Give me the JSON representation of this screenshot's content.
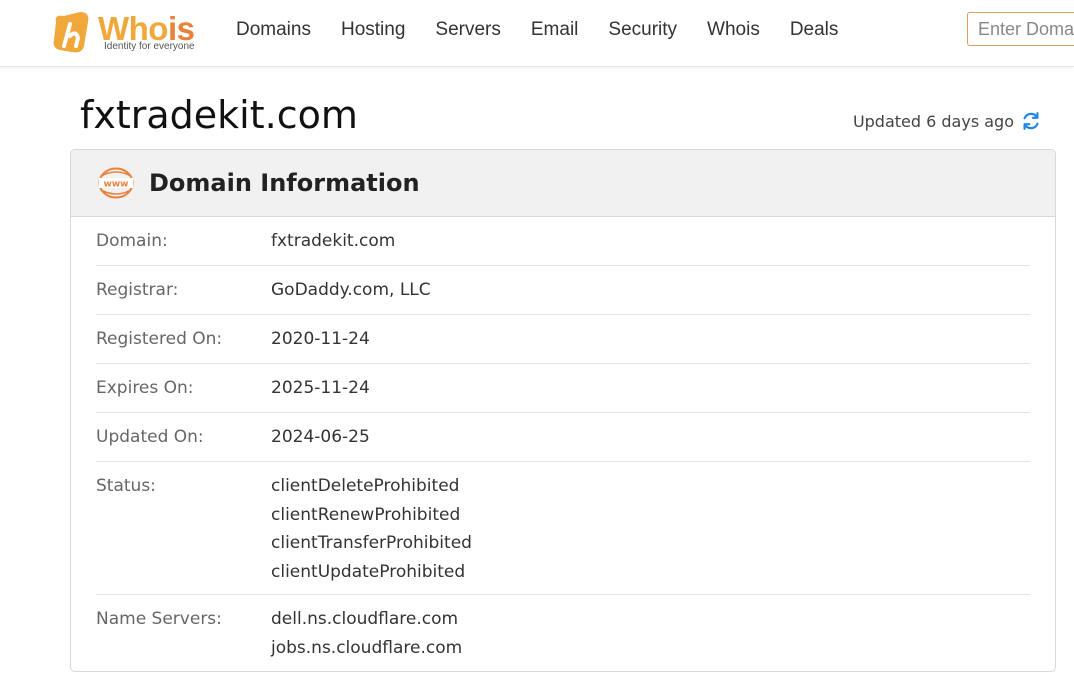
{
  "header": {
    "logo_text_a": "Who",
    "logo_text_b": "is",
    "tagline": "Identity for everyone",
    "nav": [
      "Domains",
      "Hosting",
      "Servers",
      "Email",
      "Security",
      "Whois",
      "Deals"
    ],
    "search_placeholder": "Enter Domain"
  },
  "page": {
    "title": "fxtradekit.com",
    "updated": "Updated 6 days ago"
  },
  "card": {
    "title": "Domain Information",
    "icon": "www-globe-icon",
    "rows": [
      {
        "label": "Domain:",
        "values": [
          "fxtradekit.com"
        ]
      },
      {
        "label": "Registrar:",
        "values": [
          "GoDaddy.com, LLC"
        ]
      },
      {
        "label": "Registered On:",
        "values": [
          "2020-11-24"
        ]
      },
      {
        "label": "Expires On:",
        "values": [
          "2025-11-24"
        ]
      },
      {
        "label": "Updated On:",
        "values": [
          "2024-06-25"
        ]
      },
      {
        "label": "Status:",
        "values": [
          "clientDeleteProhibited",
          "clientRenewProhibited",
          "clientTransferProhibited",
          "clientUpdateProhibited"
        ]
      },
      {
        "label": "Name Servers:",
        "values": [
          "dell.ns.cloudflare.com",
          "jobs.ns.cloudflare.com"
        ]
      }
    ]
  },
  "colors": {
    "accent_orange": "#e8813a",
    "accent_yellow": "#f0a83a",
    "refresh_blue": "#1e88e5"
  }
}
